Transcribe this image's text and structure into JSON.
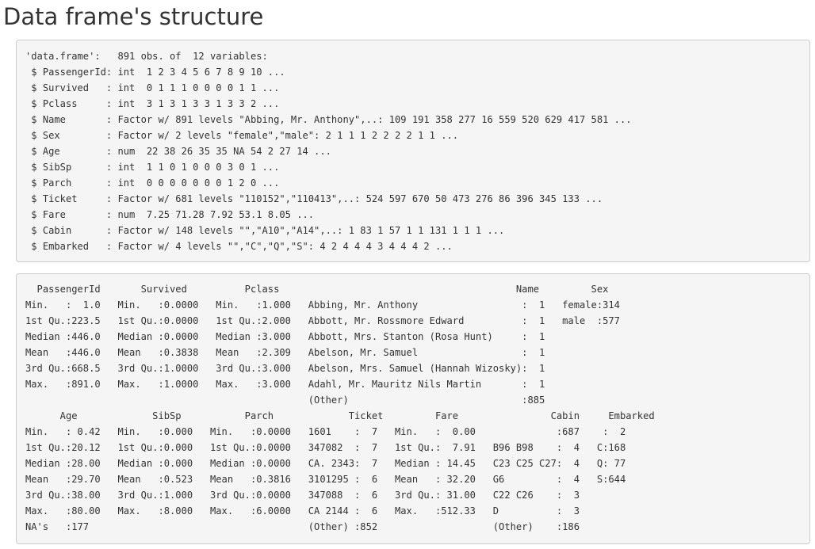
{
  "page": {
    "title": "Data frame's structure"
  },
  "str_output": {
    "lines": [
      "'data.frame':   891 obs. of  12 variables:",
      " $ PassengerId: int  1 2 3 4 5 6 7 8 9 10 ...",
      " $ Survived   : int  0 1 1 1 0 0 0 0 1 1 ...",
      " $ Pclass     : int  3 1 3 1 3 3 1 3 3 2 ...",
      " $ Name       : Factor w/ 891 levels \"Abbing, Mr. Anthony\",..: 109 191 358 277 16 559 520 629 417 581 ...",
      " $ Sex        : Factor w/ 2 levels \"female\",\"male\": 2 1 1 1 2 2 2 2 1 1 ...",
      " $ Age        : num  22 38 26 35 35 NA 54 2 27 14 ...",
      " $ SibSp      : int  1 1 0 1 0 0 0 3 0 1 ...",
      " $ Parch      : int  0 0 0 0 0 0 0 1 2 0 ...",
      " $ Ticket     : Factor w/ 681 levels \"110152\",\"110413\",..: 524 597 670 50 473 276 86 396 345 133 ...",
      " $ Fare       : num  7.25 71.28 7.92 53.1 8.05 ...",
      " $ Cabin      : Factor w/ 148 levels \"\",\"A10\",\"A14\",..: 1 83 1 57 1 1 131 1 1 1 ...",
      " $ Embarked   : Factor w/ 4 levels \"\",\"C\",\"Q\",\"S\": 4 2 4 4 4 3 4 4 4 2 ..."
    ]
  },
  "summary_output": {
    "lines": [
      "  PassengerId       Survived          Pclass                                         Name         Sex     ",
      "Min.   :  1.0   Min.   :0.0000   Min.   :1.000   Abbing, Mr. Anthony                  :  1   female:314  ",
      "1st Qu.:223.5   1st Qu.:0.0000   1st Qu.:2.000   Abbott, Mr. Rossmore Edward          :  1   male  :577  ",
      "Median :446.0   Median :0.0000   Median :3.000   Abbott, Mrs. Stanton (Rosa Hunt)     :  1               ",
      "Mean   :446.0   Mean   :0.3838   Mean   :2.309   Abelson, Mr. Samuel                  :  1               ",
      "3rd Qu.:668.5   3rd Qu.:1.0000   3rd Qu.:3.000   Abelson, Mrs. Samuel (Hannah Wizosky):  1               ",
      "Max.   :891.0   Max.   :1.0000   Max.   :3.000   Adahl, Mr. Mauritz Nils Martin       :  1               ",
      "                                                 (Other)                              :885               ",
      "      Age             SibSp           Parch             Ticket         Fare                Cabin     Embarked",
      "Min.   : 0.42   Min.   :0.000   Min.   :0.0000   1601    :  7   Min.   :  0.00              :687    :  2   ",
      "1st Qu.:20.12   1st Qu.:0.000   1st Qu.:0.0000   347082  :  7   1st Qu.:  7.91   B96 B98    :  4   C:168   ",
      "Median :28.00   Median :0.000   Median :0.0000   CA. 2343:  7   Median : 14.45   C23 C25 C27:  4   Q: 77   ",
      "Mean   :29.70   Mean   :0.523   Mean   :0.3816   3101295 :  6   Mean   : 32.20   G6         :  4   S:644   ",
      "3rd Qu.:38.00   3rd Qu.:1.000   3rd Qu.:0.0000   347088  :  6   3rd Qu.: 31.00   C22 C26    :  3           ",
      "Max.   :80.00   Max.   :8.000   Max.   :6.0000   CA 2144 :  6   Max.   :512.33   D          :  3           ",
      "NA's   :177                                      (Other) :852                    (Other)    :186           "
    ]
  }
}
